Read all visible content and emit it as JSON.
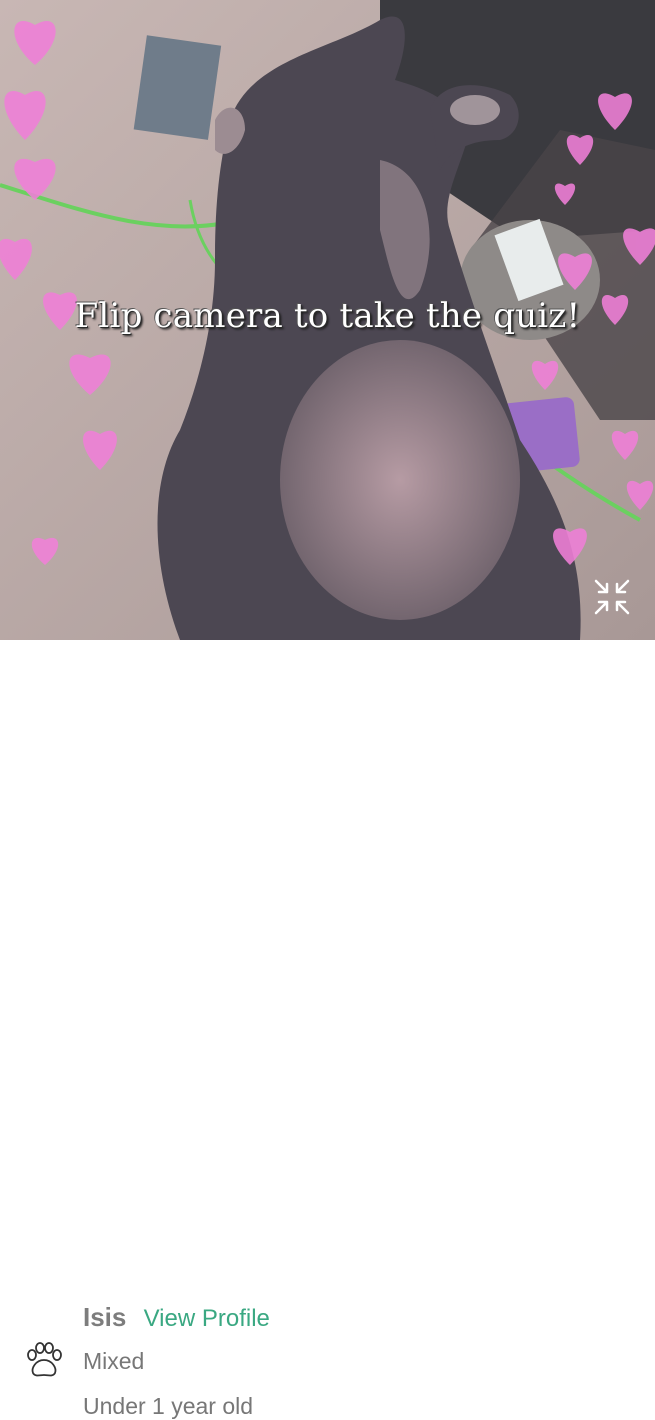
{
  "photo": {
    "overlay_text": "Flip camera to take the quiz!",
    "collapse_icon": "collapse-arrows-icon"
  },
  "pet": {
    "name": "Isis",
    "view_profile_label": "View Profile",
    "breed": "Mixed",
    "age": "Under 1 year old",
    "breed_icon": "paw-icon"
  },
  "colors": {
    "accent": "#3aa882",
    "text_muted": "#777777",
    "heart": "#f07fd8"
  }
}
